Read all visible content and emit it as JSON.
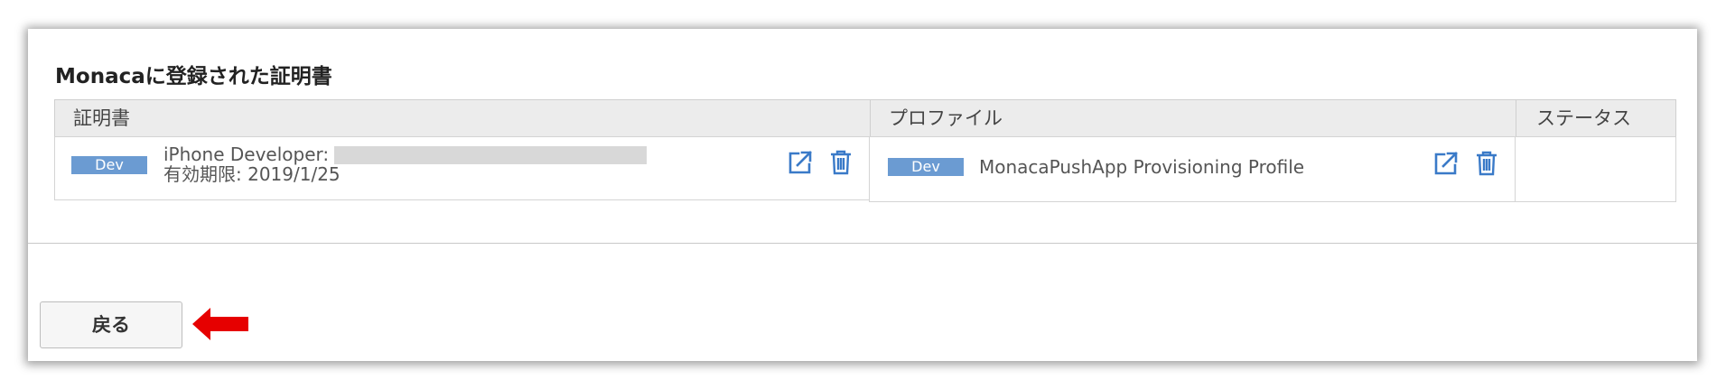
{
  "section": {
    "title": "Monacaに登録された証明書"
  },
  "table": {
    "headers": {
      "certificate": "証明書",
      "profile": "プロファイル",
      "status": "ステータス"
    },
    "row": {
      "certificate": {
        "badge": "Dev",
        "name_prefix": "iPhone Developer:",
        "name_redacted": true,
        "expiry": "有効期限: 2019/1/25"
      },
      "profile": {
        "badge": "Dev",
        "name": "MonacaPushApp Provisioning Profile"
      },
      "status": ""
    }
  },
  "actions": {
    "back_label": "戻る"
  },
  "icons": {
    "open": "external-link-icon",
    "delete": "trash-icon",
    "pointer": "red-arrow-left"
  },
  "colors": {
    "badge": "#6b9bd2",
    "icon": "#3a7ac8",
    "arrow": "#e60000",
    "header_bg": "#ececec"
  }
}
